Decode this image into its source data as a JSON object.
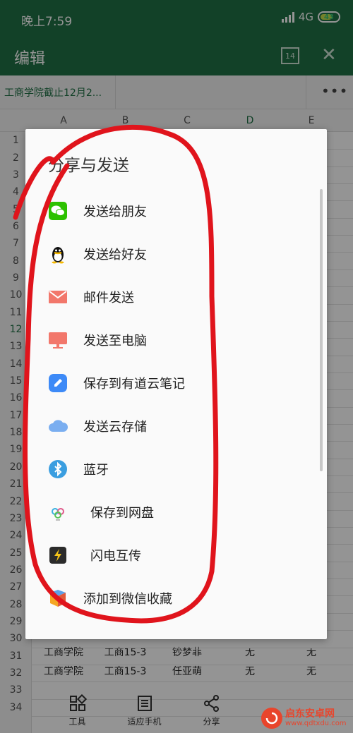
{
  "status_bar": {
    "time": "晚上7:59",
    "network": "4G",
    "battery": "43"
  },
  "app_bar": {
    "title": "编辑",
    "page_count": "14"
  },
  "sheet_tab": {
    "name": "工商学院截止12月2...",
    "more": "•••"
  },
  "grid": {
    "columns": [
      "A",
      "B",
      "C",
      "D",
      "E"
    ],
    "rows": [
      "1",
      "2",
      "3",
      "4",
      "5",
      "6",
      "7",
      "8",
      "9",
      "10",
      "11",
      "12",
      "13",
      "14",
      "15",
      "16",
      "17",
      "18",
      "19",
      "20",
      "21",
      "22",
      "23",
      "24",
      "25",
      "26",
      "27",
      "28",
      "29",
      "30",
      "31",
      "32",
      "33",
      "34"
    ],
    "visible_cells": [
      {
        "row": "30",
        "a": "工商学院",
        "b": "工商15-3",
        "c": "钞梦菲",
        "d": "无",
        "e": "无"
      },
      {
        "row": "31",
        "a": "工商学院",
        "b": "工商15-3",
        "c": "任亚萌",
        "d": "无",
        "e": "无"
      }
    ]
  },
  "dialog": {
    "title": "分享与发送",
    "items": [
      {
        "label": "发送给朋友",
        "icon": "wechat-icon",
        "color": "#2dc100"
      },
      {
        "label": "发送给好友",
        "icon": "qq-penguin-icon",
        "color": "#111111"
      },
      {
        "label": "邮件发送",
        "icon": "mail-icon",
        "color": "#f2776b"
      },
      {
        "label": "发送至电脑",
        "icon": "monitor-icon",
        "color": "#f2776b"
      },
      {
        "label": "保存到有道云笔记",
        "icon": "youdao-note-icon",
        "color": "#3d8af7"
      },
      {
        "label": "发送云存储",
        "icon": "cloud-icon",
        "color": "#7aaef0"
      },
      {
        "label": "蓝牙",
        "icon": "bluetooth-icon",
        "color": "#3a9ee0"
      },
      {
        "label": "保存到网盘",
        "icon": "netdisk-icon",
        "color": "#3ab0e0"
      },
      {
        "label": "闪电互传",
        "icon": "lightning-icon",
        "color": "#f5c518"
      },
      {
        "label": "添加到微信收藏",
        "icon": "wechat-favorite-icon",
        "color": "#f5a623"
      }
    ]
  },
  "toolbar": {
    "items": [
      {
        "label": "工具",
        "icon": "tools-grid-icon"
      },
      {
        "label": "适应手机",
        "icon": "fit-phone-icon"
      },
      {
        "label": "分享",
        "icon": "share-icon"
      }
    ]
  },
  "watermark": {
    "brand": "启东安卓网",
    "url": "www.qdtxdu.com"
  },
  "colors": {
    "brand_green": "#1f7145",
    "annotation_red": "#e0141c"
  }
}
